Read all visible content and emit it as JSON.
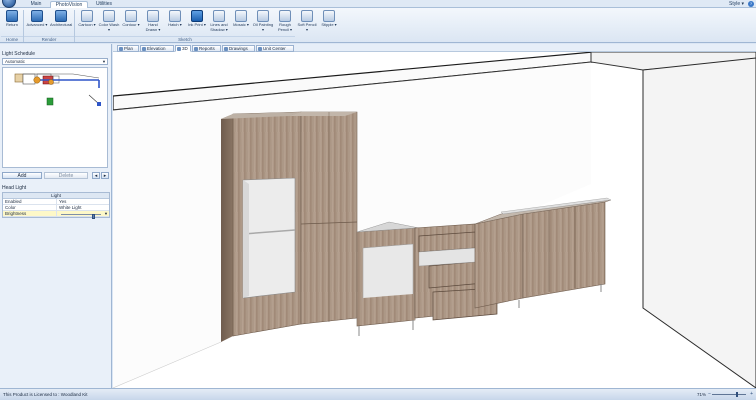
{
  "ribbon_tabs": [
    "Main",
    "PhotoVision",
    "Utilities"
  ],
  "active_tab": "PhotoVision",
  "style_menu": "Style ▾",
  "help_icon": "?",
  "ribbon_buttons": [
    {
      "label": "Return",
      "icon": "return-icon",
      "style": "blue"
    },
    {
      "label": "Advanced ▾",
      "icon": "advanced-render-icon",
      "style": "blue"
    },
    {
      "label": "Architectural",
      "icon": "architectural-render-icon",
      "style": "blue"
    },
    {
      "label": "Cartoon ▾",
      "icon": "cartoon-icon",
      "style": "plain"
    },
    {
      "label": "Color Wash ▾",
      "icon": "color-wash-icon",
      "style": "plain"
    },
    {
      "label": "Contour ▾",
      "icon": "contour-icon",
      "style": "plain"
    },
    {
      "label": "Hand Drawn ▾",
      "icon": "hand-drawn-icon",
      "style": "plain"
    },
    {
      "label": "Hatch ▾",
      "icon": "hatch-icon",
      "style": "plain"
    },
    {
      "label": "Ink Print ▾",
      "icon": "ink-print-icon",
      "style": "sel"
    },
    {
      "label": "Lines and Shadow ▾",
      "icon": "lines-shadow-icon",
      "style": "plain"
    },
    {
      "label": "Mosaic ▾",
      "icon": "mosaic-icon",
      "style": "plain"
    },
    {
      "label": "Oil Painting ▾",
      "icon": "oil-painting-icon",
      "style": "plain"
    },
    {
      "label": "Rough Pencil ▾",
      "icon": "rough-pencil-icon",
      "style": "plain"
    },
    {
      "label": "Soft Pencil ▾",
      "icon": "soft-pencil-icon",
      "style": "plain"
    },
    {
      "label": "Stipple ▾",
      "icon": "stipple-icon",
      "style": "plain"
    }
  ],
  "ribbon_groups": [
    "Home",
    "Render",
    "Sketch"
  ],
  "left_panel": {
    "schedule_title": "Light Schedule",
    "schedule_value": "Automatic",
    "add_label": "Add",
    "delete_label": "Delete",
    "prev_label": "◂",
    "next_label": "▸",
    "light_title": "Head Light",
    "props_header": "Light",
    "props": [
      {
        "key": "Enabled",
        "value": "Yes"
      },
      {
        "key": "Color",
        "value": "White Light"
      },
      {
        "key": "Brightness",
        "value": ""
      }
    ],
    "brightness_level": 0.78
  },
  "view_tabs": [
    {
      "label": "Plan",
      "icon": "plan-view-icon"
    },
    {
      "label": "Elevation",
      "icon": "elevation-view-icon"
    },
    {
      "label": "3D",
      "icon": "3d-view-icon"
    },
    {
      "label": "Reports",
      "icon": "reports-icon"
    },
    {
      "label": "Drawings",
      "icon": "drawings-icon"
    },
    {
      "label": "Unit Center",
      "icon": "unit-center-icon"
    }
  ],
  "active_view": "3D",
  "status": {
    "text": "This Product is Licensed to : Woodland Kit",
    "zoom": "71%",
    "zoom_level": 0.7,
    "zoom_minus": "−",
    "zoom_plus": "+"
  }
}
